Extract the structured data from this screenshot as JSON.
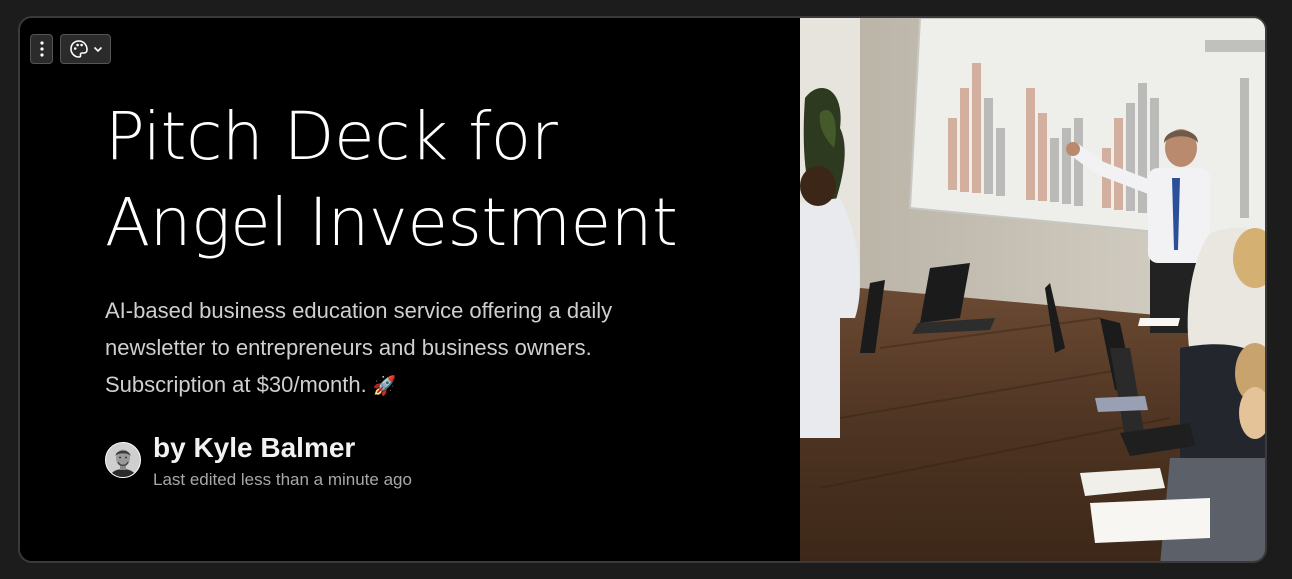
{
  "toolbar": {
    "more_icon": "vertical-dots-icon",
    "theme_icon": "palette-icon",
    "theme_chevron_icon": "chevron-down-icon"
  },
  "card": {
    "title_line1": "Pitch Deck for",
    "title_line2": "Angel Investment",
    "description_line1": "AI-based business education service offering a daily",
    "description_line2": "newsletter to entrepreneurs and business owners.",
    "description_line3": "Subscription at $30/month.",
    "description_emoji": "🚀",
    "author": "by Kyle Balmer",
    "edited": "Last edited less than a minute ago",
    "image_alt": "Presenter pointing at bar chart projection in a meeting room"
  },
  "colors": {
    "background": "#1c1c1c",
    "card": "#000000",
    "text": "#ffffff",
    "muted": "#a8a8a8"
  }
}
